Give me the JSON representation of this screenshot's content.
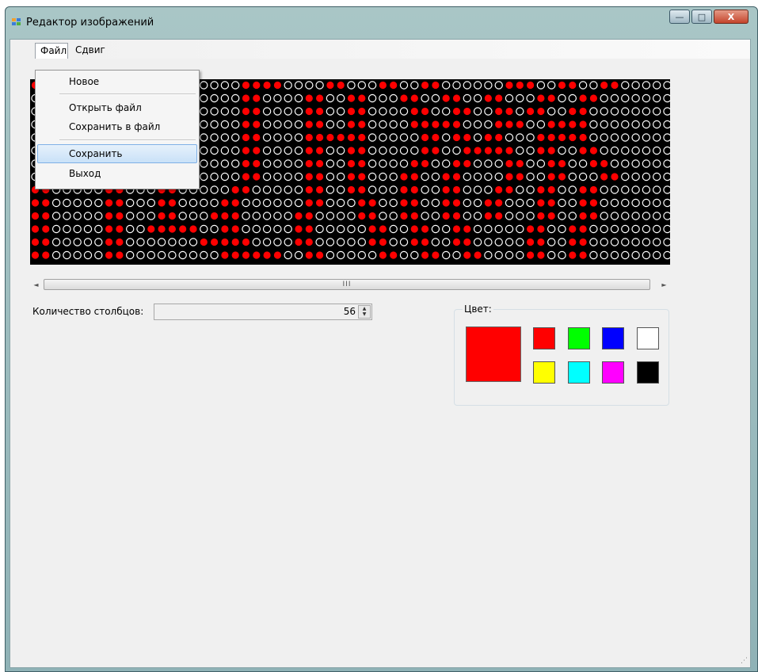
{
  "window": {
    "title": "Редактор изображений"
  },
  "controls": {
    "minimize": "—",
    "maximize": "□",
    "close": "X"
  },
  "menu": {
    "file": "Файл",
    "shift": "Сдвиг"
  },
  "file_menu": {
    "items": [
      "Новое",
      "Открыть файл",
      "Сохранить в файл",
      "Сохранить",
      "Выход"
    ],
    "highlighted": "Сохранить"
  },
  "led_matrix": {
    "on_color": "#ff0000",
    "off_color": "#ffffff",
    "background": "#000000",
    "rows": [
      "1100000000000000000011110000110001100110000001110011001100000",
      "0000000000000000000011000011001100011001100110001100110000000",
      "0000000000000000000011000011001100001100110011011001100000000",
      "0000000000000000000011000011001100001111100011100111100000000",
      "0000000000000000000011000011111100000110110110001111100000000",
      "0000000000000000000011000011001100000110011111001100110000000",
      "0000000000000000000011000011001100001100110001100110011000000",
      "0000000000000000000011000011001100011001100001100110001100000",
      "1100000110001100000110000011001100011001100011001100110000000",
      "1100000110001100001100000011000110011001100110001100110000000",
      "1100000110001100011100000110000110011001100110001100110000000",
      "1100000110011111001100000110000011001100110000011001100000000",
      "1100000110000000111110000110000011001100110000011001100000000",
      "1100000110000000001111110011000001100110011000011001100000000"
    ]
  },
  "scrollbar": {
    "left": "◄",
    "right": "►",
    "grip": "III"
  },
  "columns": {
    "label": "Количество столбцов:",
    "value": "56",
    "up": "▲",
    "down": "▼"
  },
  "color_group": {
    "title": "Цвет:",
    "selected": "#ff0000",
    "palette": [
      "#ff0000",
      "#00ff00",
      "#0000ff",
      "#ffffff",
      "#ffff00",
      "#00ffff",
      "#ff00ff",
      "#000000"
    ]
  }
}
